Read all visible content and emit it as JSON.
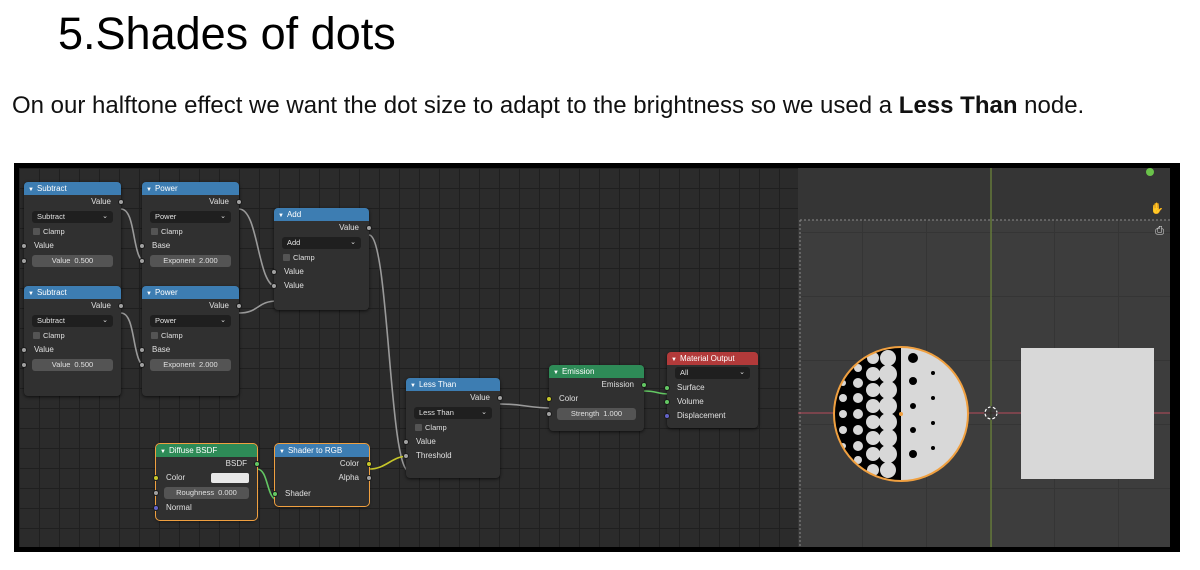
{
  "slide": {
    "title": "5.Shades of dots",
    "body_prefix": "On our halftone effect we want the dot size to adapt to the brightness so we used a ",
    "body_bold": "Less Than",
    "body_suffix": " node."
  },
  "colors": {
    "header_converter": "#3d7db2",
    "header_shader": "#2e8b57",
    "header_output": "#b23a3a",
    "socket_float": "#a1a1a1",
    "socket_color": "#c7c729",
    "socket_shader": "#63c763",
    "socket_vector": "#6363c7",
    "selection": "#f0a040"
  },
  "icons": {
    "collapse": "triangle-down",
    "dropdown": "chevron-down",
    "gizmo_move": "hand",
    "gizmo_camera": "camera"
  },
  "nodes": {
    "subtract1": {
      "title": "Subtract",
      "out_value": "Value",
      "operation": "Subtract",
      "clamp": "Clamp",
      "in_value": "Value",
      "field_label": "Value",
      "field_value": "0.500"
    },
    "subtract2": {
      "title": "Subtract",
      "out_value": "Value",
      "operation": "Subtract",
      "clamp": "Clamp",
      "in_value": "Value",
      "field_label": "Value",
      "field_value": "0.500"
    },
    "power1": {
      "title": "Power",
      "out_value": "Value",
      "operation": "Power",
      "clamp": "Clamp",
      "base": "Base",
      "field_label": "Exponent",
      "field_value": "2.000"
    },
    "power2": {
      "title": "Power",
      "out_value": "Value",
      "operation": "Power",
      "clamp": "Clamp",
      "base": "Base",
      "field_label": "Exponent",
      "field_value": "2.000"
    },
    "add": {
      "title": "Add",
      "out_value": "Value",
      "operation": "Add",
      "clamp": "Clamp",
      "in_value1": "Value",
      "in_value2": "Value"
    },
    "less_than": {
      "title": "Less Than",
      "out_value": "Value",
      "operation": "Less Than",
      "clamp": "Clamp",
      "in_value": "Value",
      "in_threshold": "Threshold"
    },
    "emission": {
      "title": "Emission",
      "out_emission": "Emission",
      "in_color": "Color",
      "field_label": "Strength",
      "field_value": "1.000"
    },
    "material_output": {
      "title": "Material Output",
      "target": "All",
      "in_surface": "Surface",
      "in_volume": "Volume",
      "in_displacement": "Displacement"
    },
    "diffuse": {
      "title": "Diffuse BSDF",
      "out_bsdf": "BSDF",
      "in_color": "Color",
      "field_label": "Roughness",
      "field_value": "0.000",
      "in_normal": "Normal"
    },
    "shader_to_rgb": {
      "title": "Shader to RGB",
      "out_color": "Color",
      "out_alpha": "Alpha",
      "in_shader": "Shader"
    }
  }
}
